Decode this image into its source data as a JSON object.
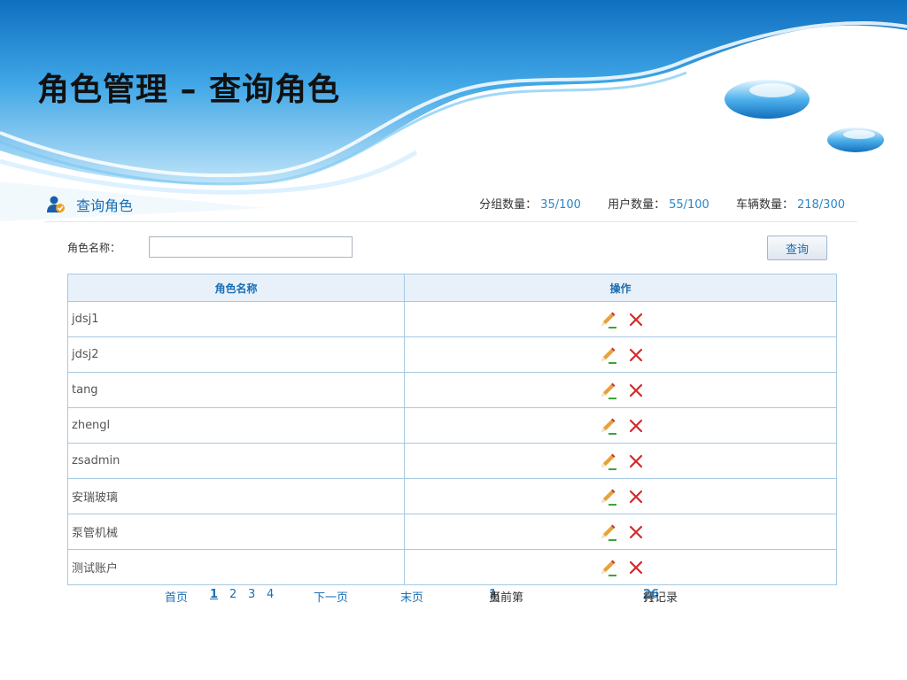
{
  "page": {
    "title": "角色管理 – 查询角色"
  },
  "section": {
    "title": "查询角色",
    "icon": "user-icon",
    "stats": [
      {
        "label": "分组数量：",
        "value": "35/100"
      },
      {
        "label": "用户数量：",
        "value": "55/100"
      },
      {
        "label": "车辆数量：",
        "value": "218/300"
      }
    ]
  },
  "search": {
    "label": "角色名称：",
    "value": "",
    "button_label": "查询"
  },
  "table": {
    "columns": [
      "角色名称",
      "操作"
    ],
    "rows": [
      {
        "name": "jdsj1"
      },
      {
        "name": "jdsj2"
      },
      {
        "name": "tang"
      },
      {
        "name": "zhengl"
      },
      {
        "name": "zsadmin"
      },
      {
        "name": "安瑞玻璃"
      },
      {
        "name": "泵管机械"
      },
      {
        "name": "测试账户"
      }
    ],
    "action_icons": [
      "edit-pencil-icon",
      "delete-x-icon"
    ]
  },
  "pagination": {
    "first": "首页",
    "pages": [
      "1",
      "2",
      "3",
      "4"
    ],
    "current_page": "1",
    "next": "下一页",
    "last": "末页",
    "current_prefix": "当前第",
    "current_value": "1",
    "current_suffix": "页",
    "total_prefix": "共",
    "total_value": "26",
    "total_suffix": "行记录"
  },
  "colors": {
    "accent": "#1a6fb4",
    "highlight": "#2a86c9",
    "table_border": "#a6c9e2",
    "header_bg": "#e8f1fa",
    "delete": "#d42a2a"
  }
}
